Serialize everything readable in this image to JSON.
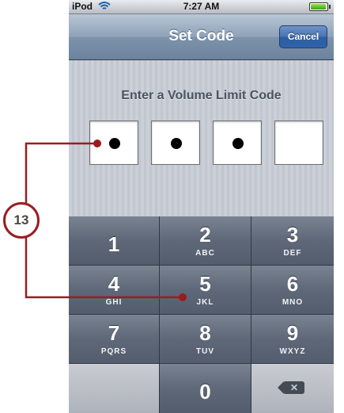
{
  "status_bar": {
    "carrier": "iPod",
    "wifi_icon": "wifi-icon",
    "time": "7:27 AM",
    "battery_level": 0.95
  },
  "nav_bar": {
    "title": "Set Code",
    "cancel_label": "Cancel"
  },
  "prompt": "Enter a Volume Limit Code",
  "code_entry": {
    "filled_count": 3,
    "total_boxes": 4
  },
  "keypad": {
    "keys": [
      {
        "num": "1",
        "letters": ""
      },
      {
        "num": "2",
        "letters": "ABC"
      },
      {
        "num": "3",
        "letters": "DEF"
      },
      {
        "num": "4",
        "letters": "GHI"
      },
      {
        "num": "5",
        "letters": "JKL"
      },
      {
        "num": "6",
        "letters": "MNO"
      },
      {
        "num": "7",
        "letters": "PQRS"
      },
      {
        "num": "8",
        "letters": "TUV"
      },
      {
        "num": "9",
        "letters": "WXYZ"
      },
      {
        "num": "0",
        "letters": ""
      }
    ],
    "delete_icon": "backspace-icon"
  },
  "callout": {
    "number": "13",
    "color": "#9b1c20"
  }
}
